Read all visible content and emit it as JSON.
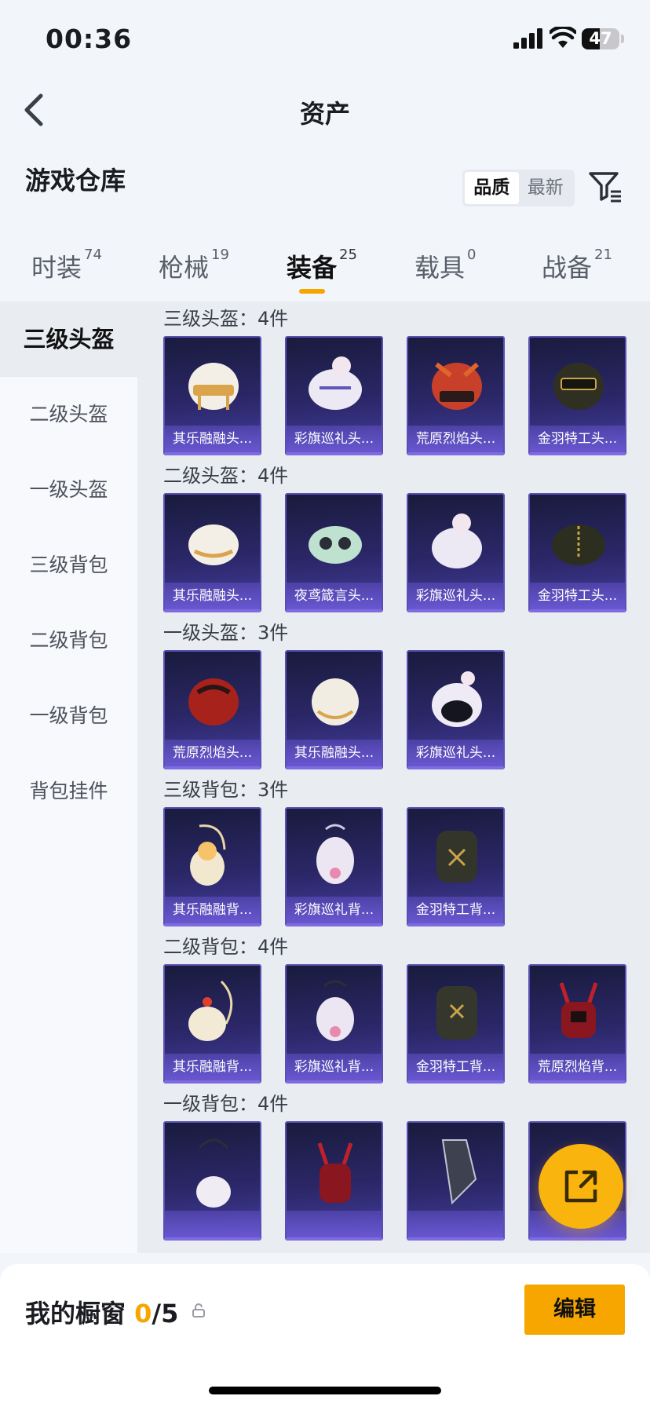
{
  "status": {
    "time": "00:36",
    "battery": "47",
    "battery_level": 0.47
  },
  "nav": {
    "title": "资产"
  },
  "section": {
    "title": "游戏仓库",
    "sort": [
      "品质",
      "最新"
    ]
  },
  "tabs": [
    {
      "label": "时装",
      "count": "74"
    },
    {
      "label": "枪械",
      "count": "19"
    },
    {
      "label": "装备",
      "count": "25"
    },
    {
      "label": "载具",
      "count": "0"
    },
    {
      "label": "战备",
      "count": "21"
    }
  ],
  "sidebar": [
    "三级头盔",
    "二级头盔",
    "一级头盔",
    "三级背包",
    "二级背包",
    "一级背包",
    "背包挂件"
  ],
  "groups": [
    {
      "title": "三级头盔：4件",
      "items": [
        "其乐融融头...",
        "彩旗巡礼头...",
        "荒原烈焰头...",
        "金羽特工头..."
      ]
    },
    {
      "title": "二级头盔：4件",
      "items": [
        "其乐融融头...",
        "夜鸢箴言头...",
        "彩旗巡礼头...",
        "金羽特工头..."
      ]
    },
    {
      "title": "一级头盔：3件",
      "items": [
        "荒原烈焰头...",
        "其乐融融头...",
        "彩旗巡礼头..."
      ]
    },
    {
      "title": "三级背包：3件",
      "items": [
        "其乐融融背...",
        "彩旗巡礼背...",
        "金羽特工背..."
      ]
    },
    {
      "title": "二级背包：4件",
      "items": [
        "其乐融融背...",
        "彩旗巡礼背...",
        "金羽特工背...",
        "荒原烈焰背..."
      ]
    },
    {
      "title": "一级背包：4件",
      "items": [
        "",
        "",
        "",
        ""
      ]
    }
  ],
  "showcase": {
    "label": "我的橱窗",
    "used": "0",
    "total": "/5",
    "edit": "编辑"
  },
  "colors": {
    "accent": "#f7a600",
    "card": "#2b2768"
  }
}
